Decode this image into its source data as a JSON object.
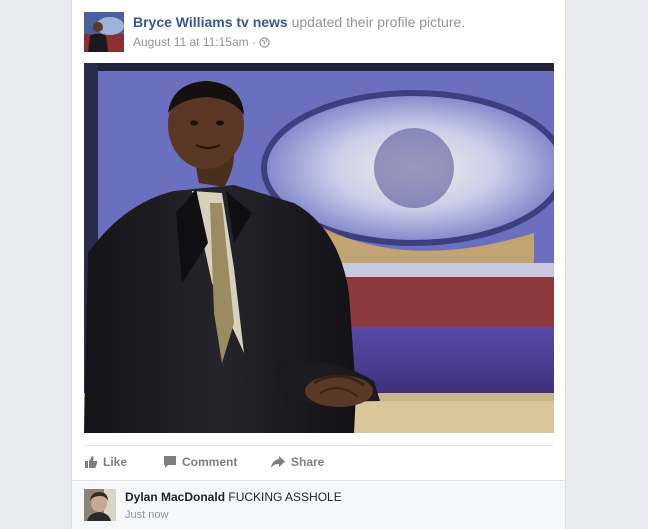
{
  "post": {
    "author": "Bryce Williams tv news",
    "action_text": "updated their profile picture.",
    "timestamp": "August 11 at 11:15am",
    "separator": "·",
    "privacy_icon": "globe-icon"
  },
  "actions": {
    "like": "Like",
    "comment": "Comment",
    "share": "Share"
  },
  "comment": {
    "author": "Dylan MacDonald",
    "text": "FUCKING ASSHOLE",
    "time": "Just now"
  },
  "colors": {
    "link": "#365899",
    "meta": "#90949c",
    "background": "#e9ebee"
  }
}
